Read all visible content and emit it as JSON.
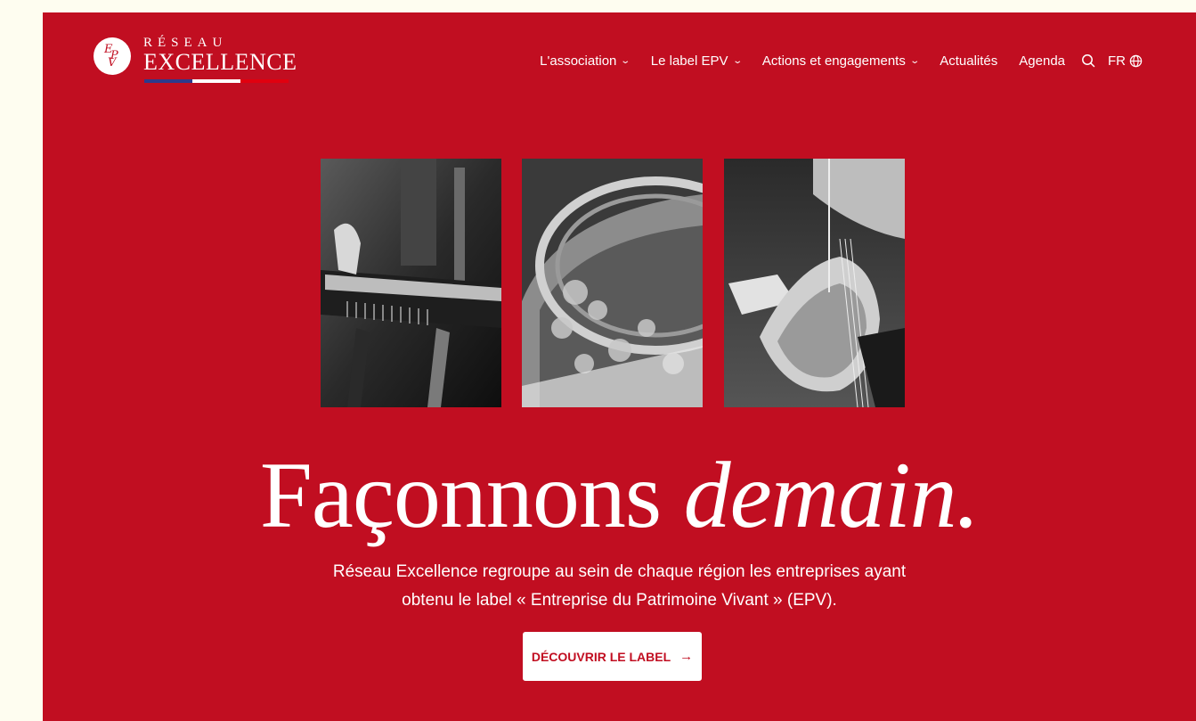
{
  "logo": {
    "monogram": [
      "E",
      "P",
      "V"
    ],
    "line1": "RÉSEAU",
    "line2": "EXCELLENCE",
    "stripe_colors": [
      "#2d3a8c",
      "#ffffff",
      "#e1000f"
    ]
  },
  "nav": {
    "items": [
      {
        "label": "L'association",
        "has_dropdown": true
      },
      {
        "label": "Le label EPV",
        "has_dropdown": true
      },
      {
        "label": "Actions et engagements",
        "has_dropdown": true
      },
      {
        "label": "Actualités",
        "has_dropdown": false
      },
      {
        "label": "Agenda",
        "has_dropdown": false
      }
    ],
    "search_icon": "search-icon",
    "language": "FR",
    "language_icon": "globe-icon",
    "dropdown_icon": "chevron-down-icon"
  },
  "hero": {
    "background_color": "#c10e21",
    "photos": [
      {
        "subject": "craftsman-hands-on-wooden-table-edge"
      },
      {
        "subject": "ornate-carved-gilded-frame-detail"
      },
      {
        "subject": "luthier-working-on-violin"
      }
    ],
    "headline_regular": "Façonnons ",
    "headline_italic": "demain.",
    "subtitle_line1": "Réseau Excellence regroupe au sein de chaque région les entreprises ayant",
    "subtitle_line2": "obtenu le label « Entreprise du Patrimoine Vivant » (EPV).",
    "cta_label": "DÉCOUVRIR LE LABEL",
    "cta_icon": "arrow-right-icon"
  },
  "colors": {
    "page_background": "#fefdf0",
    "accent": "#c10e21",
    "text_on_accent": "#ffffff"
  }
}
